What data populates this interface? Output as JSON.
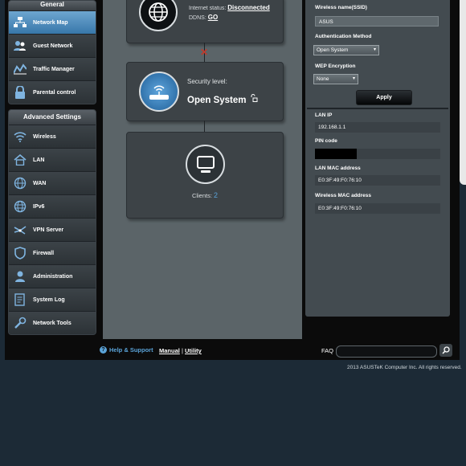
{
  "sidebar": {
    "general": {
      "header": "General",
      "items": [
        {
          "label": "Network Map",
          "icon": "network-map-icon"
        },
        {
          "label": "Guest Network",
          "icon": "guest-network-icon"
        },
        {
          "label": "Traffic Manager",
          "icon": "traffic-manager-icon"
        },
        {
          "label": "Parental control",
          "icon": "lock-icon"
        }
      ]
    },
    "advanced": {
      "header": "Advanced Settings",
      "items": [
        {
          "label": "Wireless",
          "icon": "wifi-icon"
        },
        {
          "label": "LAN",
          "icon": "home-icon"
        },
        {
          "label": "WAN",
          "icon": "globe-icon"
        },
        {
          "label": "IPv6",
          "icon": "ipv6-globe-icon"
        },
        {
          "label": "VPN Server",
          "icon": "vpn-icon"
        },
        {
          "label": "Firewall",
          "icon": "shield-icon"
        },
        {
          "label": "Administration",
          "icon": "person-icon"
        },
        {
          "label": "System Log",
          "icon": "log-icon"
        },
        {
          "label": "Network Tools",
          "icon": "tools-icon"
        }
      ]
    }
  },
  "internet": {
    "status_label": "Internet status:",
    "status_value": "Disconnected",
    "ddns_label": "DDNS:",
    "ddns_value": "GO"
  },
  "router": {
    "security_label": "Security level:",
    "security_value": "Open System"
  },
  "clients": {
    "label": "Clients:",
    "count": "2"
  },
  "panel": {
    "ssid_label": "Wireless name(SSID)",
    "ssid_value": "ASUS",
    "auth_label": "Authentication Method",
    "auth_value": "Open System",
    "wep_label": "WEP Encryption",
    "wep_value": "None",
    "apply_label": "Apply",
    "lan_ip_label": "LAN IP",
    "lan_ip_value": "192.168.1.1",
    "pin_label": "PIN code",
    "lan_mac_label": "LAN MAC address",
    "lan_mac_value": "E0:3F:49:F0:76:10",
    "wireless_mac_label": "Wireless MAC address",
    "wireless_mac_value": "E0:3F:49:F0:76:10"
  },
  "footer": {
    "help_label": "Help & Support",
    "manual_label": "Manual",
    "separator": "|",
    "utility_label": "Utility",
    "faq_label": "FAQ",
    "copyright": "2013 ASUSTeK Computer Inc. All rights reserved."
  },
  "colors": {
    "accent": "#4f8fbf",
    "link": "#5aa3d8",
    "error": "#c0392b"
  }
}
